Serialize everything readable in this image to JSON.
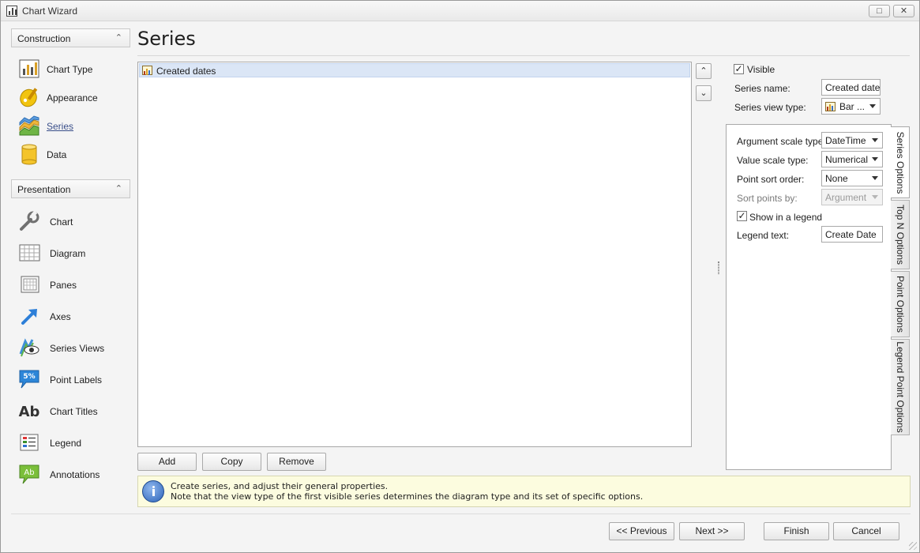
{
  "window": {
    "title": "Chart Wizard",
    "maximize_glyph": "□",
    "close_glyph": "✕"
  },
  "nav": {
    "groups": [
      {
        "label": "Construction",
        "collapse_glyph": "⌃",
        "items": [
          {
            "label": "Chart Type",
            "icon": "chart-type-icon"
          },
          {
            "label": "Appearance",
            "icon": "appearance-icon"
          },
          {
            "label": "Series",
            "icon": "series-icon",
            "active": true
          },
          {
            "label": "Data",
            "icon": "data-icon"
          }
        ]
      },
      {
        "label": "Presentation",
        "collapse_glyph": "⌃",
        "items": [
          {
            "label": "Chart",
            "icon": "wrench-icon"
          },
          {
            "label": "Diagram",
            "icon": "diagram-icon"
          },
          {
            "label": "Panes",
            "icon": "panes-icon"
          },
          {
            "label": "Axes",
            "icon": "axes-icon"
          },
          {
            "label": "Series Views",
            "icon": "series-views-icon"
          },
          {
            "label": "Point Labels",
            "icon": "point-labels-icon",
            "badge": "5%"
          },
          {
            "label": "Chart Titles",
            "icon": "chart-titles-icon",
            "badge": "Ab"
          },
          {
            "label": "Legend",
            "icon": "legend-icon"
          },
          {
            "label": "Annotations",
            "icon": "annotations-icon",
            "badge": "Ab"
          }
        ]
      }
    ]
  },
  "page": {
    "title": "Series"
  },
  "series_list": {
    "items": [
      {
        "label": "Created dates",
        "selected": true
      }
    ],
    "move_up_glyph": "⌃",
    "move_down_glyph": "⌄"
  },
  "list_buttons": {
    "add": "Add",
    "copy": "Copy",
    "remove": "Remove"
  },
  "properties": {
    "visible": {
      "label": "Visible",
      "checked": true,
      "check_glyph": "✓"
    },
    "series_name": {
      "label": "Series name:",
      "value": "Created dates"
    },
    "series_view_type": {
      "label": "Series view type:",
      "value": "Bar ..."
    }
  },
  "series_options": {
    "argument_scale_type": {
      "label": "Argument scale type:",
      "value": "DateTime"
    },
    "value_scale_type": {
      "label": "Value scale type:",
      "value": "Numerical"
    },
    "point_sort_order": {
      "label": "Point sort order:",
      "value": "None"
    },
    "sort_points_by": {
      "label": "Sort points by:",
      "value": "Argument",
      "disabled": true
    },
    "show_in_legend": {
      "label": "Show in a legend",
      "checked": true,
      "check_glyph": "✓"
    },
    "legend_text": {
      "label": "Legend text:",
      "value": "Create Date"
    }
  },
  "option_tabs": [
    {
      "label": "Series Options",
      "active": true
    },
    {
      "label": "Top N Options"
    },
    {
      "label": "Point Options"
    },
    {
      "label": "Legend Point Options"
    }
  ],
  "info": {
    "line1": "Create series, and adjust their general properties.",
    "line2": "Note that the view type of the first visible series determines the diagram type and its set of specific options."
  },
  "footer": {
    "previous": "<< Previous",
    "next": "Next >>",
    "finish": "Finish",
    "cancel": "Cancel"
  },
  "colors": {
    "selection": "#dbe6f6",
    "info_background": "#fcfcdf",
    "accent_blue": "#2c63b8"
  }
}
